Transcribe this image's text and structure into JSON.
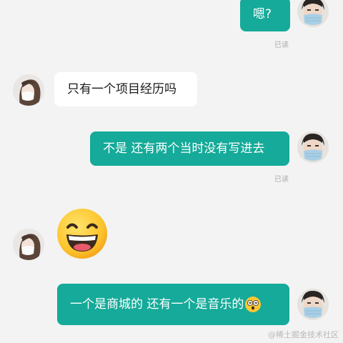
{
  "colors": {
    "outgoing_bubble": "#15aa99",
    "incoming_bubble": "#ffffff",
    "background": "#f3f3f3"
  },
  "messages": [
    {
      "side": "outgoing",
      "text": "嗯?",
      "receipt": "已读"
    },
    {
      "side": "incoming",
      "text": "只有一个项目经历吗"
    },
    {
      "side": "outgoing",
      "text": "不是 还有两个当时没有写进去",
      "receipt": "已读"
    },
    {
      "side": "incoming",
      "sticker": "grinning-face-emoji"
    },
    {
      "side": "outgoing",
      "text": "一个是商城的 还有一个是音乐的",
      "trailing_emoji": "dizzy-face-emoji"
    }
  ],
  "watermark": {
    "text": "@稀土掘金技术社区"
  }
}
